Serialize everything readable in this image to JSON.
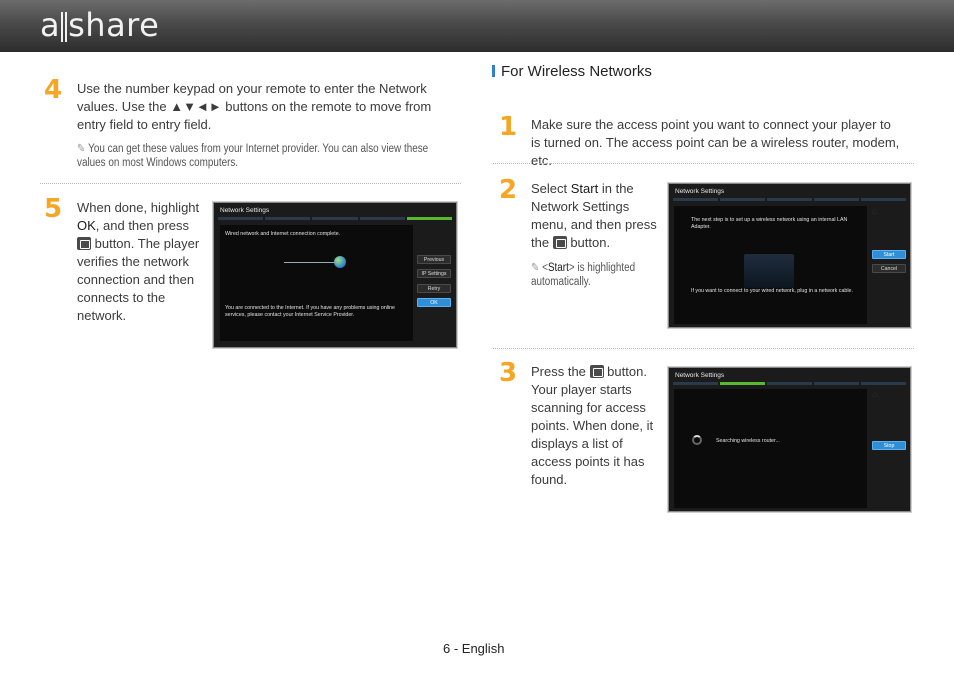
{
  "header": {
    "logo_left": "a",
    "logo_right": "share"
  },
  "left": {
    "step4": {
      "num": "4",
      "text": "Use the number keypad on your remote to enter the Network values. Use the ▲▼◄► buttons on the remote to move from entry field to entry field.",
      "note": "You can get these values from your Internet provider. You can also view these values on most Windows computers."
    },
    "step5": {
      "num": "5",
      "text_before": "When done, highlight",
      "ok": "OK",
      "text_mid": ", and then press",
      "text_after": "button. The player verifies the network connection and then connects to the network."
    },
    "screen": {
      "title": "Network Settings",
      "line1": "Wired network and Internet connection complete.",
      "line2": "You are connected to the Internet. If you have any problems using online services, please contact your Internet Service Provider.",
      "buttons": [
        "Previous",
        "IP Settings",
        "Retry",
        "OK"
      ]
    }
  },
  "right": {
    "section_title": "For Wireless Networks",
    "step1": {
      "num": "1",
      "text": "Make sure the access point you want to connect your player to is turned on. The access point can be a wireless router, modem, etc."
    },
    "step2": {
      "num": "2",
      "text_before": "Select",
      "start": "Start",
      "text_mid": "in the Network Settings menu, and then press the",
      "text_after": "button.",
      "note_pre": "<",
      "note_word": "Start",
      "note_post": "> is highlighted automatically.",
      "screen": {
        "title": "Network Settings",
        "line1": "The next step is to set up a wireless network using an internal LAN Adapter.",
        "line2": "If you want to connect to your wired network, plug in a network cable.",
        "buttons": [
          "Start",
          "Cancel"
        ]
      }
    },
    "step3": {
      "num": "3",
      "text_before": "Press the",
      "text_after": "button. Your player starts scanning for access points. When done, it displays a list of access points it has found.",
      "screen": {
        "title": "Network Settings",
        "line1": "Searching wireless router...",
        "buttons": [
          "Stop"
        ]
      }
    }
  },
  "footer": {
    "page": "6 - English"
  }
}
